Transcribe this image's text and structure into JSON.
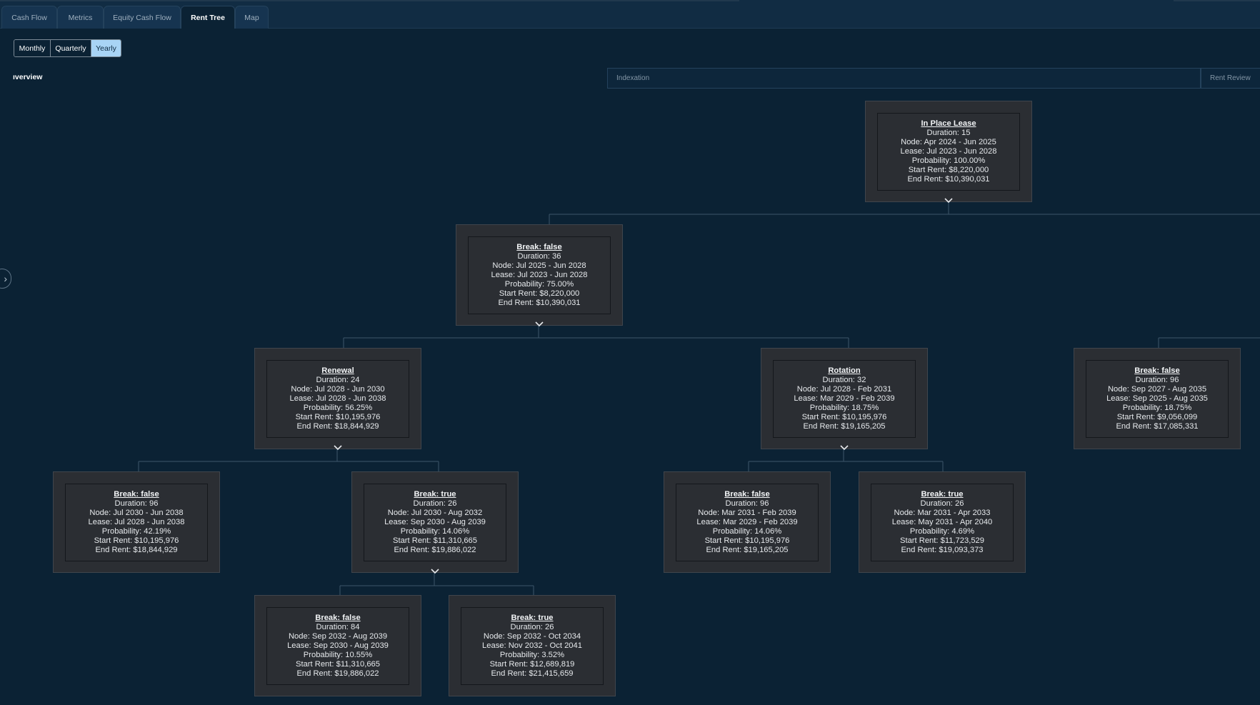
{
  "tabs": [
    {
      "label": "Cash Flow",
      "active": false
    },
    {
      "label": "Metrics",
      "active": false
    },
    {
      "label": "Equity Cash Flow",
      "active": false
    },
    {
      "label": "Rent Tree",
      "active": true
    },
    {
      "label": "Map",
      "active": false
    }
  ],
  "period": {
    "options": [
      "Monthly",
      "Quarterly",
      "Yearly"
    ],
    "selected": "Yearly"
  },
  "overview_label": "ıverview",
  "column_headers": {
    "indexation": "Indexation",
    "rent_review": "Rent Review"
  },
  "icons": {
    "expand": "chevron-down-icon",
    "side_toggle": "chevron-right-icon"
  },
  "colors": {
    "background": "#0b2234",
    "node_fill": "#2b2e33",
    "active_toggle": "#a8d4f5",
    "connector": "#3d556a"
  },
  "nodes": [
    {
      "id": "n0",
      "title": "In Place Lease",
      "duration": "Duration: 15",
      "node": "Node: Apr 2024 - Jun 2025",
      "lease": "Lease: Jul 2023 - Jun 2028",
      "probability": "Probability: 100.00%",
      "start_rent": "Start Rent: $8,220,000",
      "end_rent": "End Rent: $10,390,031",
      "expandable": true
    },
    {
      "id": "n1",
      "title": "Break: false",
      "duration": "Duration: 36",
      "node": "Node: Jul 2025 - Jun 2028",
      "lease": "Lease: Jul 2023 - Jun 2028",
      "probability": "Probability: 75.00%",
      "start_rent": "Start Rent: $8,220,000",
      "end_rent": "End Rent: $10,390,031",
      "expandable": true
    },
    {
      "id": "n2",
      "title": "Renewal",
      "duration": "Duration: 24",
      "node": "Node: Jul 2028 - Jun 2030",
      "lease": "Lease: Jul 2028 - Jun 2038",
      "probability": "Probability: 56.25%",
      "start_rent": "Start Rent: $10,195,976",
      "end_rent": "End Rent: $18,844,929",
      "expandable": true
    },
    {
      "id": "n3",
      "title": "Rotation",
      "duration": "Duration: 32",
      "node": "Node: Jul 2028 - Feb 2031",
      "lease": "Lease: Mar 2029 - Feb 2039",
      "probability": "Probability: 18.75%",
      "start_rent": "Start Rent: $10,195,976",
      "end_rent": "End Rent: $19,165,205",
      "expandable": true
    },
    {
      "id": "n4",
      "title": "Break: false",
      "duration": "Duration: 96",
      "node": "Node: Sep 2027 - Aug 2035",
      "lease": "Lease: Sep 2025 - Aug 2035",
      "probability": "Probability: 18.75%",
      "start_rent": "Start Rent: $9,056,099",
      "end_rent": "End Rent: $17,085,331",
      "expandable": false
    },
    {
      "id": "n5",
      "title": "Break: false",
      "duration": "Duration: 96",
      "node": "Node: Jul 2030 - Jun 2038",
      "lease": "Lease: Jul 2028 - Jun 2038",
      "probability": "Probability: 42.19%",
      "start_rent": "Start Rent: $10,195,976",
      "end_rent": "End Rent: $18,844,929",
      "expandable": false
    },
    {
      "id": "n6",
      "title": "Break: true",
      "duration": "Duration: 26",
      "node": "Node: Jul 2030 - Aug 2032",
      "lease": "Lease: Sep 2030 - Aug 2039",
      "probability": "Probability: 14.06%",
      "start_rent": "Start Rent: $11,310,665",
      "end_rent": "End Rent: $19,886,022",
      "expandable": true
    },
    {
      "id": "n7",
      "title": "Break: false",
      "duration": "Duration: 96",
      "node": "Node: Mar 2031 - Feb 2039",
      "lease": "Lease: Mar 2029 - Feb 2039",
      "probability": "Probability: 14.06%",
      "start_rent": "Start Rent: $10,195,976",
      "end_rent": "End Rent: $19,165,205",
      "expandable": false
    },
    {
      "id": "n8",
      "title": "Break: true",
      "duration": "Duration: 26",
      "node": "Node: Mar 2031 - Apr 2033",
      "lease": "Lease: May 2031 - Apr 2040",
      "probability": "Probability: 4.69%",
      "start_rent": "Start Rent: $11,723,529",
      "end_rent": "End Rent: $19,093,373",
      "expandable": false
    },
    {
      "id": "n9",
      "title": "Break: false",
      "duration": "Duration: 84",
      "node": "Node: Sep 2032 - Aug 2039",
      "lease": "Lease: Sep 2030 - Aug 2039",
      "probability": "Probability: 10.55%",
      "start_rent": "Start Rent: $11,310,665",
      "end_rent": "End Rent: $19,886,022",
      "expandable": false
    },
    {
      "id": "n10",
      "title": "Break: true",
      "duration": "Duration: 26",
      "node": "Node: Sep 2032 - Oct 2034",
      "lease": "Lease: Nov 2032 - Oct 2041",
      "probability": "Probability: 3.52%",
      "start_rent": "Start Rent: $12,689,819",
      "end_rent": "End Rent: $21,415,659",
      "expandable": false
    }
  ]
}
